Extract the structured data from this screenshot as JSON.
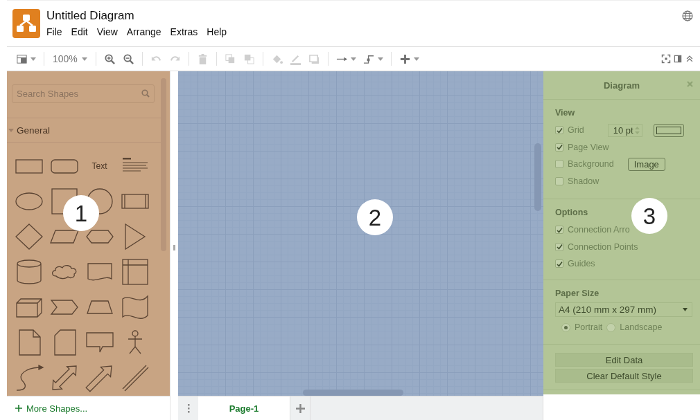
{
  "header": {
    "title": "Untitled Diagram",
    "menu": [
      {
        "label": "File"
      },
      {
        "label": "Edit"
      },
      {
        "label": "View"
      },
      {
        "label": "Arrange"
      },
      {
        "label": "Extras"
      },
      {
        "label": "Help"
      }
    ]
  },
  "toolbar": {
    "items": [
      {
        "kind": "format",
        "disabled": false
      },
      {
        "kind": "separator"
      },
      {
        "kind": "zoom",
        "label": "100%",
        "disabled": false
      },
      {
        "kind": "separator"
      },
      {
        "kind": "zoom-in",
        "disabled": false
      },
      {
        "kind": "zoom-out",
        "disabled": false
      },
      {
        "kind": "separator"
      },
      {
        "kind": "undo",
        "disabled": true
      },
      {
        "kind": "redo",
        "disabled": true
      },
      {
        "kind": "separator"
      },
      {
        "kind": "delete",
        "disabled": true
      },
      {
        "kind": "separator"
      },
      {
        "kind": "to-front",
        "disabled": true
      },
      {
        "kind": "to-back",
        "disabled": true
      },
      {
        "kind": "separator"
      },
      {
        "kind": "fill",
        "disabled": true
      },
      {
        "kind": "line",
        "disabled": true
      },
      {
        "kind": "shadow",
        "disabled": true
      },
      {
        "kind": "separator"
      },
      {
        "kind": "connection",
        "disabled": false
      },
      {
        "kind": "waypoints",
        "disabled": false
      },
      {
        "kind": "separator"
      },
      {
        "kind": "insert",
        "disabled": false
      }
    ],
    "right": [
      {
        "kind": "fullscreen"
      },
      {
        "kind": "panel"
      },
      {
        "kind": "collapse"
      }
    ]
  },
  "sidebar": {
    "search": {
      "placeholder": "Search Shapes"
    },
    "section": {
      "title": "General",
      "expanded": true
    },
    "shapes": [
      {
        "kind": "rect"
      },
      {
        "kind": "rounded"
      },
      {
        "kind": "text",
        "label": "Text"
      },
      {
        "kind": "heading"
      },
      {
        "kind": "ellipse"
      },
      {
        "kind": "square"
      },
      {
        "kind": "circle"
      },
      {
        "kind": "process"
      },
      {
        "kind": "diamond"
      },
      {
        "kind": "parallelogram"
      },
      {
        "kind": "hexagon"
      },
      {
        "kind": "triangle"
      },
      {
        "kind": "cylinder"
      },
      {
        "kind": "cloud"
      },
      {
        "kind": "document"
      },
      {
        "kind": "storage"
      },
      {
        "kind": "cube"
      },
      {
        "kind": "step"
      },
      {
        "kind": "trapezoid"
      },
      {
        "kind": "tape"
      },
      {
        "kind": "note"
      },
      {
        "kind": "card"
      },
      {
        "kind": "callout"
      },
      {
        "kind": "actor"
      },
      {
        "kind": "curve"
      },
      {
        "kind": "double-arrow"
      },
      {
        "kind": "arrow"
      },
      {
        "kind": "link"
      }
    ],
    "more": "More Shapes..."
  },
  "format_panel": {
    "title": "Diagram",
    "view": {
      "title": "View",
      "options": [
        {
          "label": "Grid",
          "checked": true,
          "kind": "grid"
        },
        {
          "label": "Page View",
          "checked": true,
          "kind": "plain"
        },
        {
          "label": "Background",
          "checked": false,
          "kind": "background"
        },
        {
          "label": "Shadow",
          "checked": false,
          "kind": "plain"
        }
      ],
      "grid_size": "10 pt",
      "image_button": "Image"
    },
    "options": {
      "title": "Options",
      "options": [
        {
          "label": "Connection Arro",
          "checked": true
        },
        {
          "label": "Connection Points",
          "checked": true
        },
        {
          "label": "Guides",
          "checked": true
        }
      ]
    },
    "paper_size": {
      "title": "Paper Size",
      "value": "A4 (210 mm x 297 mm)",
      "orientations": [
        {
          "label": "Portrait",
          "selected": true
        },
        {
          "label": "Landscape",
          "selected": false
        }
      ]
    },
    "buttons": [
      "Edit Data",
      "Clear Default Style"
    ]
  },
  "pages": [
    {
      "label": "Page-1",
      "selected": true
    }
  ],
  "callouts": [
    "1",
    "2",
    "3"
  ]
}
